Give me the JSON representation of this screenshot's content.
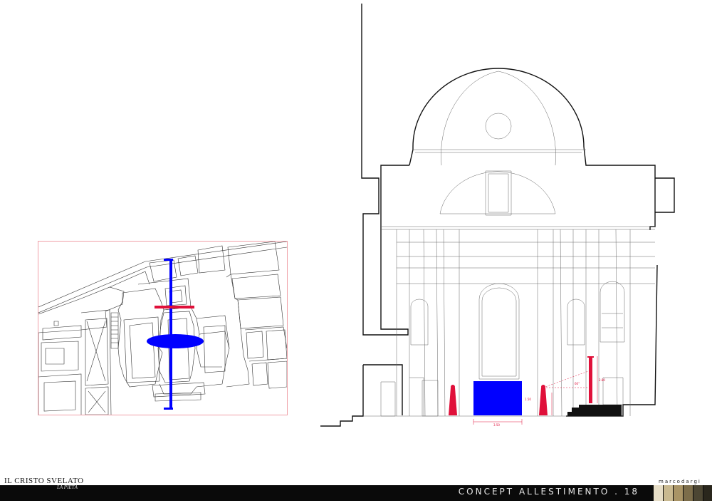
{
  "footer": {
    "title": "CONCEPT ALLESTIMENTO . 18",
    "logo_main": "IL CRISTO SVELATO",
    "logo_sub": "LA PIETÀ",
    "brand": "marcodargi"
  },
  "section_dimensions": {
    "width_label": "3.50",
    "height_label": "1.50",
    "red_height_label": "2.80",
    "sightline_label": "60°"
  },
  "palette": {
    "swatches": [
      "#e6ddc6",
      "#c9b990",
      "#a99466",
      "#7c6d4a",
      "#4c4633",
      "#2a271d"
    ],
    "accent_red": "#e0103a",
    "accent_blue": "#0000ff"
  }
}
